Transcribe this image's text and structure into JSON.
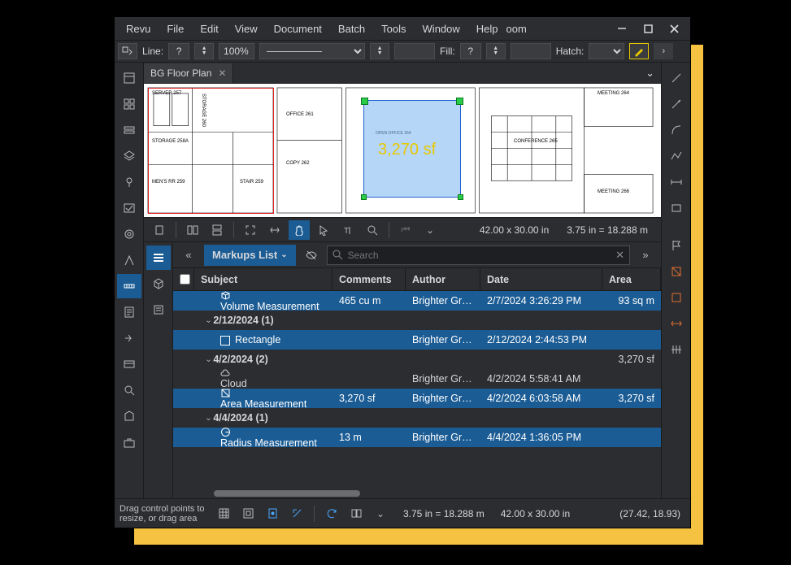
{
  "menus": [
    "Revu",
    "File",
    "Edit",
    "View",
    "Document",
    "Batch",
    "Tools",
    "Window",
    "Help"
  ],
  "zoom_label": "oom",
  "propbar": {
    "line_label": "Line:",
    "q1": "?",
    "zoom": "100%",
    "fill_label": "Fill:",
    "q2": "?",
    "hatch_label": "Hatch:",
    "chev": "›"
  },
  "tab": {
    "title": "BG Floor Plan"
  },
  "canvas": {
    "measure": "3,270 sf",
    "rooms": {
      "server": "SERVER 257",
      "stor258a": "STORAGE 258A",
      "stor260": "STORAGE 260",
      "mens": "MEN'S RR 259",
      "stair": "STAIR 259",
      "office261": "OFFICE 261",
      "copy262": "COPY 262",
      "openoffice": "OPEN OFFICE 264",
      "conf": "CONFERENCE 265",
      "meet264": "MEETING 264",
      "meet266": "MEETING 266"
    }
  },
  "viewbar": {
    "dims1": "42.00 x 30.00 in",
    "scale": "3.75 in = 18.288 m"
  },
  "panel": {
    "title": "Markups List",
    "collapse": "«",
    "expand": "»",
    "search_ph": "Search",
    "columns": {
      "subject": "Subject",
      "comments": "Comments",
      "author": "Author",
      "date": "Date",
      "area": "Area"
    },
    "rows": [
      {
        "type": "item",
        "bg": "blue",
        "subject": "Volume Measurement",
        "comments": "465 cu m",
        "author": "Brighter Graph...",
        "date": "2/7/2024 3:26:29 PM",
        "area": "93 sq m",
        "indent": 2,
        "icon": "cube"
      },
      {
        "type": "group",
        "bg": "dark",
        "label": "2/12/2024 (1)",
        "indent": 1
      },
      {
        "type": "item",
        "bg": "blue",
        "subject": "Rectangle",
        "comments": "",
        "author": "Brighter Graph...",
        "date": "2/12/2024 2:44:53 PM",
        "area": "",
        "indent": 2,
        "icon": "rect"
      },
      {
        "type": "group",
        "bg": "dark",
        "label": "4/2/2024 (2)",
        "indent": 1,
        "area": "3,270 sf"
      },
      {
        "type": "item",
        "bg": "dark",
        "subject": "Cloud",
        "comments": "",
        "author": "Brighter Graph...",
        "date": "4/2/2024 5:58:41 AM",
        "area": "",
        "indent": 2,
        "icon": "cloud"
      },
      {
        "type": "item",
        "bg": "blue",
        "subject": "Area Measurement",
        "comments": "3,270 sf",
        "author": "Brighter Graph...",
        "date": "4/2/2024 6:03:58 AM",
        "area": "3,270 sf",
        "indent": 2,
        "icon": "area"
      },
      {
        "type": "group",
        "bg": "dark",
        "label": "4/4/2024 (1)",
        "indent": 1
      },
      {
        "type": "item",
        "bg": "blue",
        "subject": "Radius Measurement",
        "comments": "13 m",
        "author": "Brighter Graph...",
        "date": "4/4/2024 1:36:05 PM",
        "area": "",
        "indent": 2,
        "icon": "radius"
      }
    ]
  },
  "status": {
    "help": "Drag control points to resize, or drag area",
    "scale": "3.75 in = 18.288 m",
    "dims": "42.00 x 30.00 in",
    "coords": "(27.42, 18.93)"
  }
}
